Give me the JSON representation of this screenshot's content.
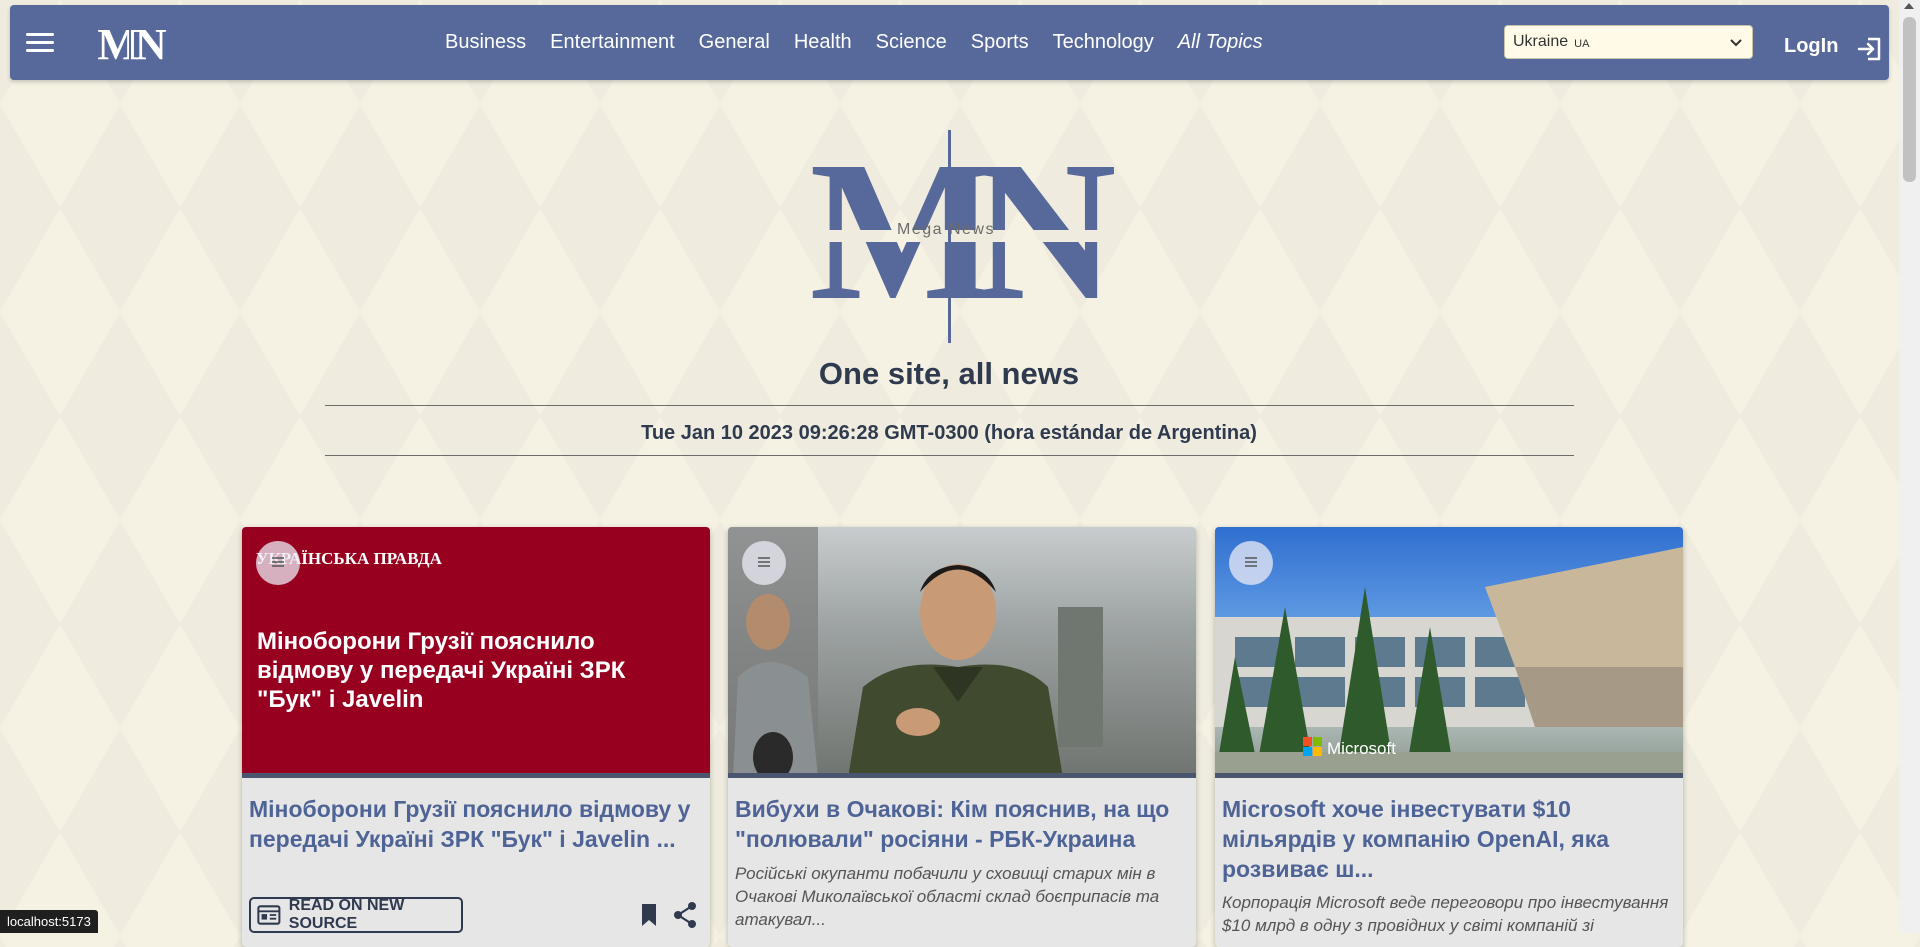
{
  "navbar": {
    "logo_text": "MN",
    "links": [
      "Business",
      "Entertainment",
      "General",
      "Health",
      "Science",
      "Sports",
      "Technology"
    ],
    "all_topics": "All Topics",
    "country": {
      "name": "Ukraine",
      "code": "UA"
    },
    "login": "LogIn"
  },
  "hero": {
    "logo_letters": "MN",
    "logo_subtitle": "Mega News",
    "tagline": "One site, all news",
    "datetime": "Tue Jan 10 2023 09:26:28 GMT-0300 (hora estándar de Argentina)"
  },
  "articles": [
    {
      "image_logo": "УКРАЇНСЬКА ПРАВДА",
      "image_title": "Міноборони Грузії пояснило відмову у передачі Україні ЗРК \"Бук\" і Javelin",
      "title": "Міноборони Грузії пояснило відмову у передачі Україні ЗРК \"Бук\" і Javelin ...",
      "description": "",
      "read_label": "READ ON NEW SOURCE"
    },
    {
      "title": "Вибухи в Очакові: Кім пояснив, на що \"полювали\" росіяни - РБК-Украина",
      "description": "Російські окупанти побачили у сховищі старих мін в Очакові Миколаївської області склад боєприпасів та атакувал..."
    },
    {
      "image_logo": "Microsoft",
      "title": "Microsoft хоче інвестувати $10 мільярдів у компанію OpenAI, яка розвиває ш...",
      "description": "Корпорація Microsoft веде переговори про інвестування $10 млрд в одну з провідних у світі компаній зі"
    }
  ],
  "statusbar": {
    "url": "localhost:5173"
  },
  "colors": {
    "navbar": "#56699a",
    "accent": "#4f6496",
    "background": "#f5f2e4",
    "pravda": "#97001f"
  }
}
